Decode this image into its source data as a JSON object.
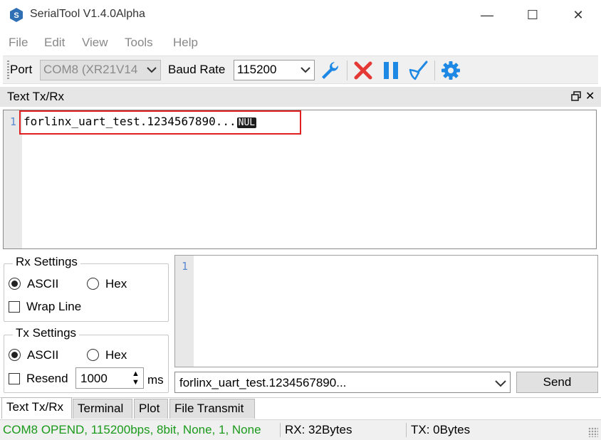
{
  "window": {
    "title": "SerialTool V1.4.0Alpha",
    "minimize": "—",
    "maximize": "☐",
    "close": "✕"
  },
  "menu": [
    "File",
    "Edit",
    "View",
    "Tools",
    "Help"
  ],
  "toolbar": {
    "port_label": "Port",
    "port_value": "COM8 (XR21V14",
    "baud_label": "Baud Rate",
    "baud_value": "115200",
    "icons": [
      "wrench-icon",
      "disconnect-x-icon",
      "pause-icon",
      "clear-brush-icon",
      "settings-gear-icon"
    ]
  },
  "dock": {
    "title": "Text Tx/Rx",
    "close": "✕"
  },
  "rx_editor": {
    "line_number": "1",
    "text": "forlinx_uart_test.1234567890...",
    "null_char": "NUL"
  },
  "rx_settings": {
    "title": "Rx Settings",
    "ascii_label": "ASCII",
    "hex_label": "Hex",
    "wrap_label": "Wrap Line",
    "mode": "ASCII",
    "wrap_checked": false
  },
  "tx_settings": {
    "title": "Tx Settings",
    "ascii_label": "ASCII",
    "hex_label": "Hex",
    "resend_label": "Resend",
    "resend_interval": "1000",
    "interval_unit": "ms",
    "mode": "ASCII",
    "resend_checked": false
  },
  "tx_editor": {
    "line_number": "1"
  },
  "send_bar": {
    "history_value": "forlinx_uart_test.1234567890...",
    "send_label": "Send"
  },
  "tabs": [
    "Text Tx/Rx",
    "Terminal",
    "Plot",
    "File Transmit"
  ],
  "active_tab": "Text Tx/Rx",
  "status": {
    "connection": "COM8 OPEND, 115200bps, 8bit, None, 1, None",
    "rx": "RX: 32Bytes",
    "tx": "TX: 0Bytes"
  },
  "colors": {
    "status_connected": "#1a9a1a",
    "highlight_border": "#e02020",
    "icon_blue": "#1e88e5",
    "icon_red": "#e53935"
  }
}
